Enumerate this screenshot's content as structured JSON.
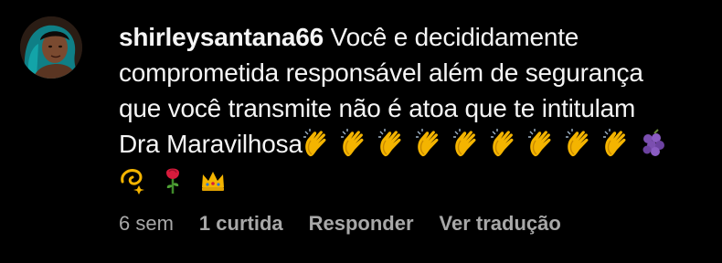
{
  "comment": {
    "username": "shirleysantana66",
    "text_line1": "Você e decididamente",
    "text_line2": "comprometida responsável além de segurança",
    "text_line3": "que você transmite não é atoa que te intitulam",
    "text_line4": "Dra Maravilhosa",
    "emojis_inline": [
      "clapping-hands",
      "clapping-hands",
      "clapping-hands",
      "clapping-hands",
      "clapping-hands",
      "clapping-hands",
      "clapping-hands",
      "clapping-hands",
      "clapping-hands",
      "grapes"
    ],
    "emojis_row2": [
      "dizzy",
      "rose",
      "crown"
    ]
  },
  "meta": {
    "time": "6 sem",
    "likes": "1 curtida",
    "reply": "Responder",
    "translate": "Ver tradução"
  },
  "colors": {
    "background": "#000000",
    "text": "#f5f5f5",
    "secondary": "#a8a8a8"
  }
}
